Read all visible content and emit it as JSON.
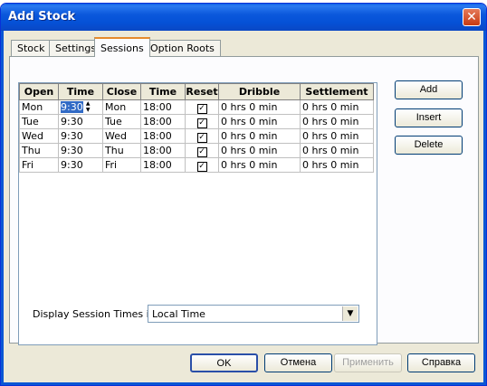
{
  "window": {
    "title": "Add Stock",
    "close_glyph": "✕"
  },
  "tabs": [
    {
      "label": "Stock",
      "active": false
    },
    {
      "label": "Settings",
      "active": false
    },
    {
      "label": "Sessions",
      "active": true
    },
    {
      "label": "Option Roots",
      "active": false
    }
  ],
  "grid": {
    "headers": [
      "Open",
      "Time",
      "Close",
      "Time",
      "Reset",
      "Dribble",
      "Settlement"
    ],
    "rows": [
      {
        "open": "Mon",
        "open_time": "9:30",
        "close": "Mon",
        "close_time": "18:00",
        "reset": true,
        "dribble": "0  hrs  0  min",
        "settlement": "0  hrs  0  min"
      },
      {
        "open": "Tue",
        "open_time": "9:30",
        "close": "Tue",
        "close_time": "18:00",
        "reset": true,
        "dribble": "0  hrs  0  min",
        "settlement": "0  hrs  0  min"
      },
      {
        "open": "Wed",
        "open_time": "9:30",
        "close": "Wed",
        "close_time": "18:00",
        "reset": true,
        "dribble": "0  hrs  0  min",
        "settlement": "0  hrs  0  min"
      },
      {
        "open": "Thu",
        "open_time": "9:30",
        "close": "Thu",
        "close_time": "18:00",
        "reset": true,
        "dribble": "0  hrs  0  min",
        "settlement": "0  hrs  0  min"
      },
      {
        "open": "Fri",
        "open_time": "9:30",
        "close": "Fri",
        "close_time": "18:00",
        "reset": true,
        "dribble": "0  hrs  0  min",
        "settlement": "0  hrs  0  min"
      }
    ]
  },
  "side_buttons": {
    "add": "Add",
    "insert": "Insert",
    "delete": "Delete"
  },
  "display": {
    "label": "Display Session Times in:",
    "value": "Local Time"
  },
  "footer": {
    "ok": "OK",
    "cancel": "Отмена",
    "apply": "Применить",
    "help": "Справка"
  },
  "icons": {
    "checkmark": "✓",
    "combo_arrow": "▼",
    "spin_up": "▲",
    "spin_down": "▼"
  }
}
